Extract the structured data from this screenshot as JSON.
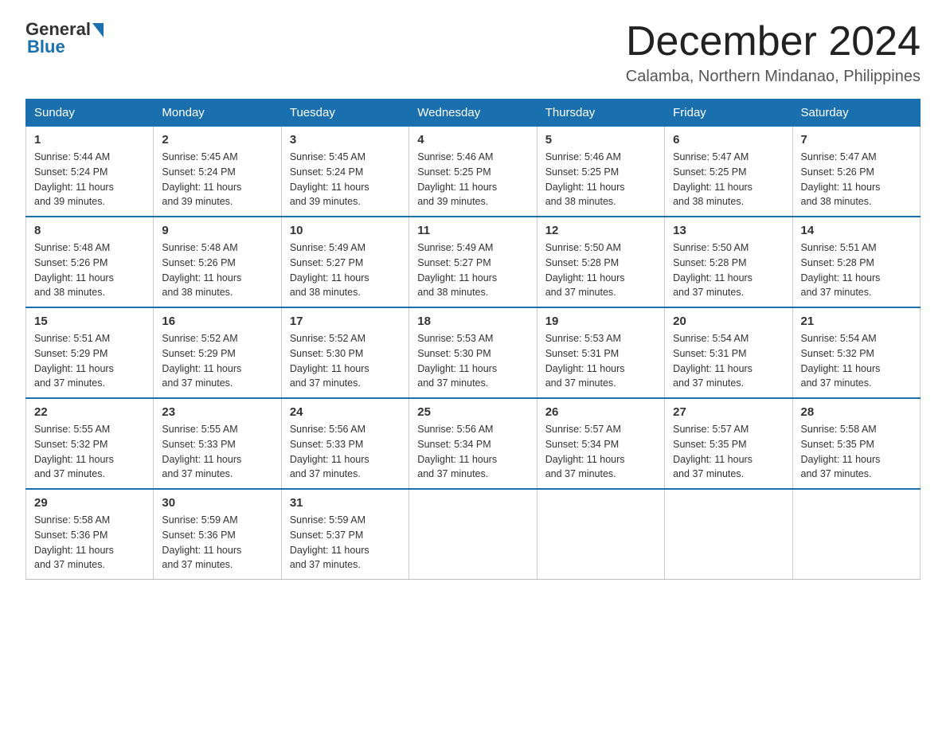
{
  "header": {
    "logo_general": "General",
    "logo_blue": "Blue",
    "month_title": "December 2024",
    "location": "Calamba, Northern Mindanao, Philippines"
  },
  "days_of_week": [
    "Sunday",
    "Monday",
    "Tuesday",
    "Wednesday",
    "Thursday",
    "Friday",
    "Saturday"
  ],
  "weeks": [
    [
      {
        "day": "1",
        "sunrise": "5:44 AM",
        "sunset": "5:24 PM",
        "daylight": "11 hours and 39 minutes."
      },
      {
        "day": "2",
        "sunrise": "5:45 AM",
        "sunset": "5:24 PM",
        "daylight": "11 hours and 39 minutes."
      },
      {
        "day": "3",
        "sunrise": "5:45 AM",
        "sunset": "5:24 PM",
        "daylight": "11 hours and 39 minutes."
      },
      {
        "day": "4",
        "sunrise": "5:46 AM",
        "sunset": "5:25 PM",
        "daylight": "11 hours and 39 minutes."
      },
      {
        "day": "5",
        "sunrise": "5:46 AM",
        "sunset": "5:25 PM",
        "daylight": "11 hours and 38 minutes."
      },
      {
        "day": "6",
        "sunrise": "5:47 AM",
        "sunset": "5:25 PM",
        "daylight": "11 hours and 38 minutes."
      },
      {
        "day": "7",
        "sunrise": "5:47 AM",
        "sunset": "5:26 PM",
        "daylight": "11 hours and 38 minutes."
      }
    ],
    [
      {
        "day": "8",
        "sunrise": "5:48 AM",
        "sunset": "5:26 PM",
        "daylight": "11 hours and 38 minutes."
      },
      {
        "day": "9",
        "sunrise": "5:48 AM",
        "sunset": "5:26 PM",
        "daylight": "11 hours and 38 minutes."
      },
      {
        "day": "10",
        "sunrise": "5:49 AM",
        "sunset": "5:27 PM",
        "daylight": "11 hours and 38 minutes."
      },
      {
        "day": "11",
        "sunrise": "5:49 AM",
        "sunset": "5:27 PM",
        "daylight": "11 hours and 38 minutes."
      },
      {
        "day": "12",
        "sunrise": "5:50 AM",
        "sunset": "5:28 PM",
        "daylight": "11 hours and 37 minutes."
      },
      {
        "day": "13",
        "sunrise": "5:50 AM",
        "sunset": "5:28 PM",
        "daylight": "11 hours and 37 minutes."
      },
      {
        "day": "14",
        "sunrise": "5:51 AM",
        "sunset": "5:28 PM",
        "daylight": "11 hours and 37 minutes."
      }
    ],
    [
      {
        "day": "15",
        "sunrise": "5:51 AM",
        "sunset": "5:29 PM",
        "daylight": "11 hours and 37 minutes."
      },
      {
        "day": "16",
        "sunrise": "5:52 AM",
        "sunset": "5:29 PM",
        "daylight": "11 hours and 37 minutes."
      },
      {
        "day": "17",
        "sunrise": "5:52 AM",
        "sunset": "5:30 PM",
        "daylight": "11 hours and 37 minutes."
      },
      {
        "day": "18",
        "sunrise": "5:53 AM",
        "sunset": "5:30 PM",
        "daylight": "11 hours and 37 minutes."
      },
      {
        "day": "19",
        "sunrise": "5:53 AM",
        "sunset": "5:31 PM",
        "daylight": "11 hours and 37 minutes."
      },
      {
        "day": "20",
        "sunrise": "5:54 AM",
        "sunset": "5:31 PM",
        "daylight": "11 hours and 37 minutes."
      },
      {
        "day": "21",
        "sunrise": "5:54 AM",
        "sunset": "5:32 PM",
        "daylight": "11 hours and 37 minutes."
      }
    ],
    [
      {
        "day": "22",
        "sunrise": "5:55 AM",
        "sunset": "5:32 PM",
        "daylight": "11 hours and 37 minutes."
      },
      {
        "day": "23",
        "sunrise": "5:55 AM",
        "sunset": "5:33 PM",
        "daylight": "11 hours and 37 minutes."
      },
      {
        "day": "24",
        "sunrise": "5:56 AM",
        "sunset": "5:33 PM",
        "daylight": "11 hours and 37 minutes."
      },
      {
        "day": "25",
        "sunrise": "5:56 AM",
        "sunset": "5:34 PM",
        "daylight": "11 hours and 37 minutes."
      },
      {
        "day": "26",
        "sunrise": "5:57 AM",
        "sunset": "5:34 PM",
        "daylight": "11 hours and 37 minutes."
      },
      {
        "day": "27",
        "sunrise": "5:57 AM",
        "sunset": "5:35 PM",
        "daylight": "11 hours and 37 minutes."
      },
      {
        "day": "28",
        "sunrise": "5:58 AM",
        "sunset": "5:35 PM",
        "daylight": "11 hours and 37 minutes."
      }
    ],
    [
      {
        "day": "29",
        "sunrise": "5:58 AM",
        "sunset": "5:36 PM",
        "daylight": "11 hours and 37 minutes."
      },
      {
        "day": "30",
        "sunrise": "5:59 AM",
        "sunset": "5:36 PM",
        "daylight": "11 hours and 37 minutes."
      },
      {
        "day": "31",
        "sunrise": "5:59 AM",
        "sunset": "5:37 PM",
        "daylight": "11 hours and 37 minutes."
      },
      null,
      null,
      null,
      null
    ]
  ],
  "labels": {
    "sunrise": "Sunrise: ",
    "sunset": "Sunset: ",
    "daylight": "Daylight: "
  }
}
